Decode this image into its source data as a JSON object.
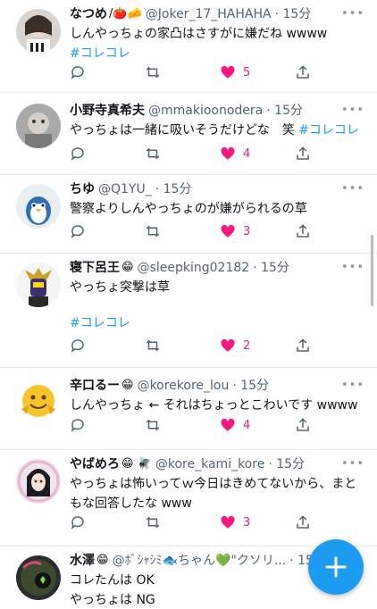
{
  "tweets": [
    {
      "name": "なつめ",
      "name_emoji": "/🍅🧀",
      "handle": "@Joker_17_HAHAHA",
      "time": "· 15分",
      "lines": [
        {
          "text": "しんやっちょの家凸はさすがに嫌だね wwww",
          "tag": ""
        },
        {
          "text": "",
          "tag": "#コレコレ"
        }
      ],
      "likes": "5",
      "avatar": "avatar-woman-photo"
    },
    {
      "name": "小野寺真希夫",
      "name_emoji": "",
      "handle": "@mmakioonodera",
      "time": "· 15分",
      "lines": [
        {
          "text": "やっちょは一緒に吸いそうだけどな　笑 ",
          "tag": "#コレコレ"
        }
      ],
      "likes": "4",
      "avatar": "avatar-man-photo"
    },
    {
      "name": "ちゆ",
      "name_emoji": "",
      "handle": "@Q1YU_",
      "time": "· 15分",
      "lines": [
        {
          "text": "警察よりしんやっちょのが嫌がられるの草",
          "tag": ""
        }
      ],
      "likes": "3",
      "avatar": "avatar-penguin"
    },
    {
      "name": "寝下呂王",
      "name_emoji": "😁",
      "handle": "@sleepking02182",
      "time": "· 15分",
      "lines": [
        {
          "text": "やっちょ突撃は草",
          "tag": ""
        },
        {
          "text": "",
          "tag": ""
        },
        {
          "text": "",
          "tag": "#コレコレ"
        }
      ],
      "likes": "2",
      "avatar": "avatar-armored-hero"
    },
    {
      "name": "辛口るー",
      "name_emoji": "😁",
      "handle": "@korekore_lou",
      "time": "· 15分",
      "lines": [
        {
          "text": "しんやっちょ ← それはちょっとこわいです wwww",
          "tag": ""
        }
      ],
      "likes": "4",
      "avatar": "avatar-yellow-emoji"
    },
    {
      "name": "やばめろ",
      "name_emoji": "😁 🪰",
      "handle": "@kore_kami_kore",
      "time": "· 15分",
      "lines": [
        {
          "text": "やっちょは怖いってｗ今日はきめてないから、まと",
          "tag": ""
        },
        {
          "text": "もな回答したな www",
          "tag": ""
        }
      ],
      "likes": "3",
      "avatar": "avatar-anime-girl"
    },
    {
      "name": "水澤",
      "name_emoji": "😁",
      "handle": "@ﾎﾞｼｬｼﾐ🐟ちゃん💚\"クソリ...",
      "time": "· 15",
      "lines": [
        {
          "text": "コレたんは OK",
          "tag": ""
        },
        {
          "text": "やっちょは NG",
          "tag": ""
        }
      ],
      "likes": "",
      "avatar": "avatar-dark-photo"
    }
  ],
  "more_icon": "more-dots-icon",
  "compose_button": "plus-icon",
  "colors": {
    "like": "#f91880",
    "link": "#1d9bf0",
    "icon": "#536471"
  }
}
